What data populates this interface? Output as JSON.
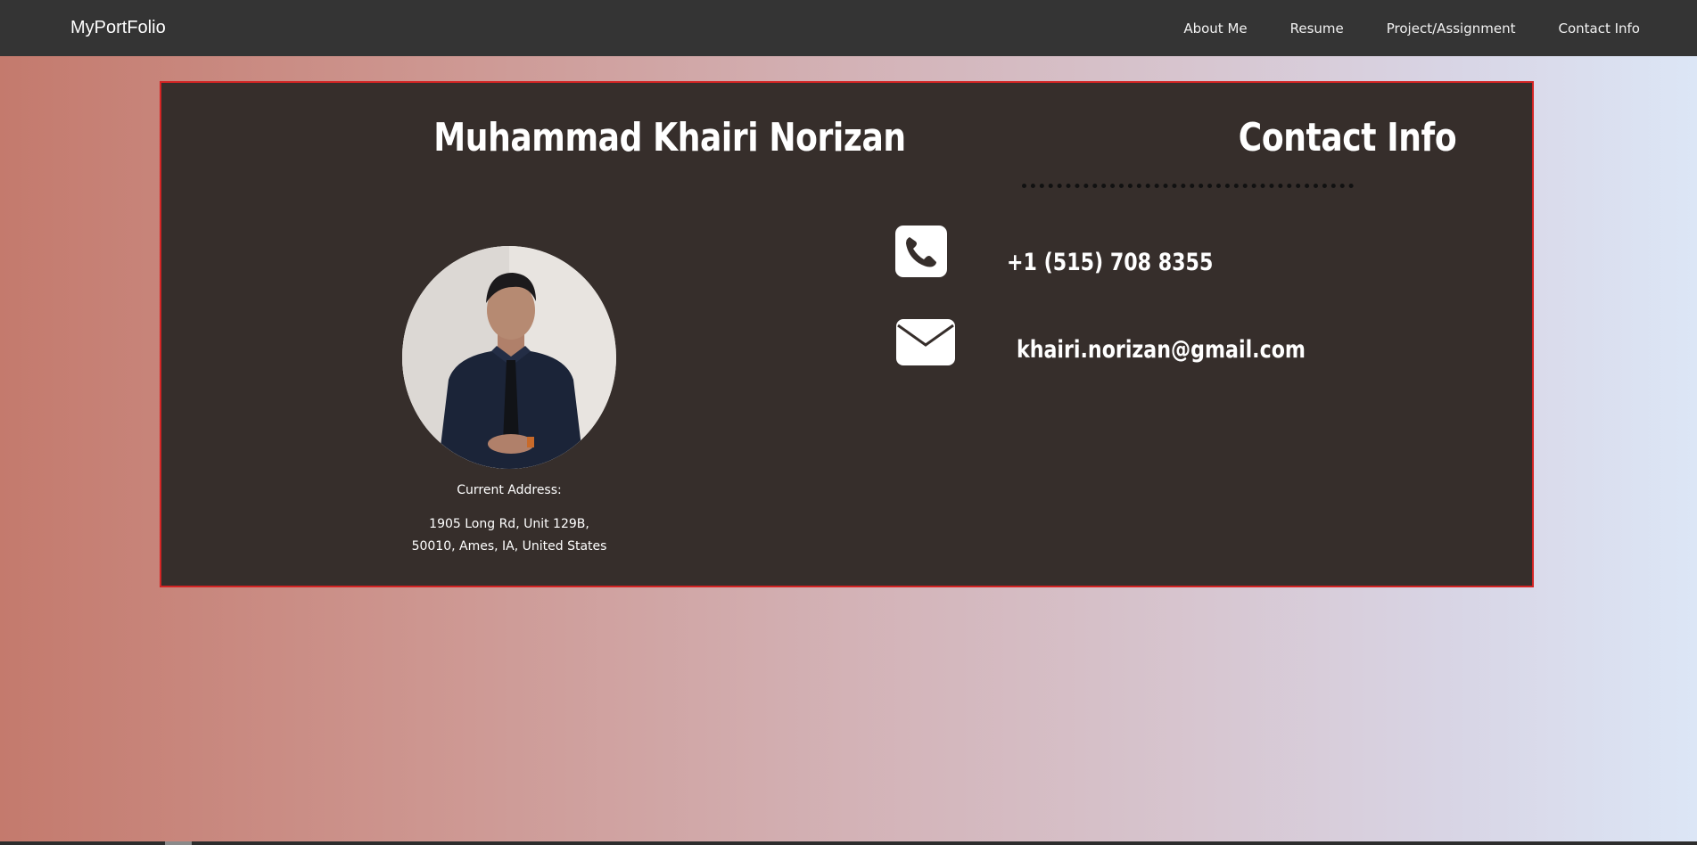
{
  "navbar": {
    "brand": "MyPortFolio",
    "links": [
      "About Me",
      "Resume",
      "Project/Assignment",
      "Contact Info"
    ]
  },
  "profile": {
    "name": "Muhammad Khairi Norizan",
    "address_label": "Current Address:",
    "address_line1": "1905 Long Rd, Unit 129B,",
    "address_line2": "50010, Ames, IA, United States"
  },
  "contact": {
    "heading": "Contact Info",
    "phone": "+1 (515) 708 8355",
    "email": "khairi.norizan@gmail.com",
    "phone_icon": "phone-icon",
    "email_icon": "envelope-icon"
  },
  "colors": {
    "navbar_bg": "#343434",
    "card_bg": "#362e2b",
    "card_border": "#d32424",
    "gradient_left": "#c47a6d",
    "gradient_right": "#dce6f6"
  }
}
